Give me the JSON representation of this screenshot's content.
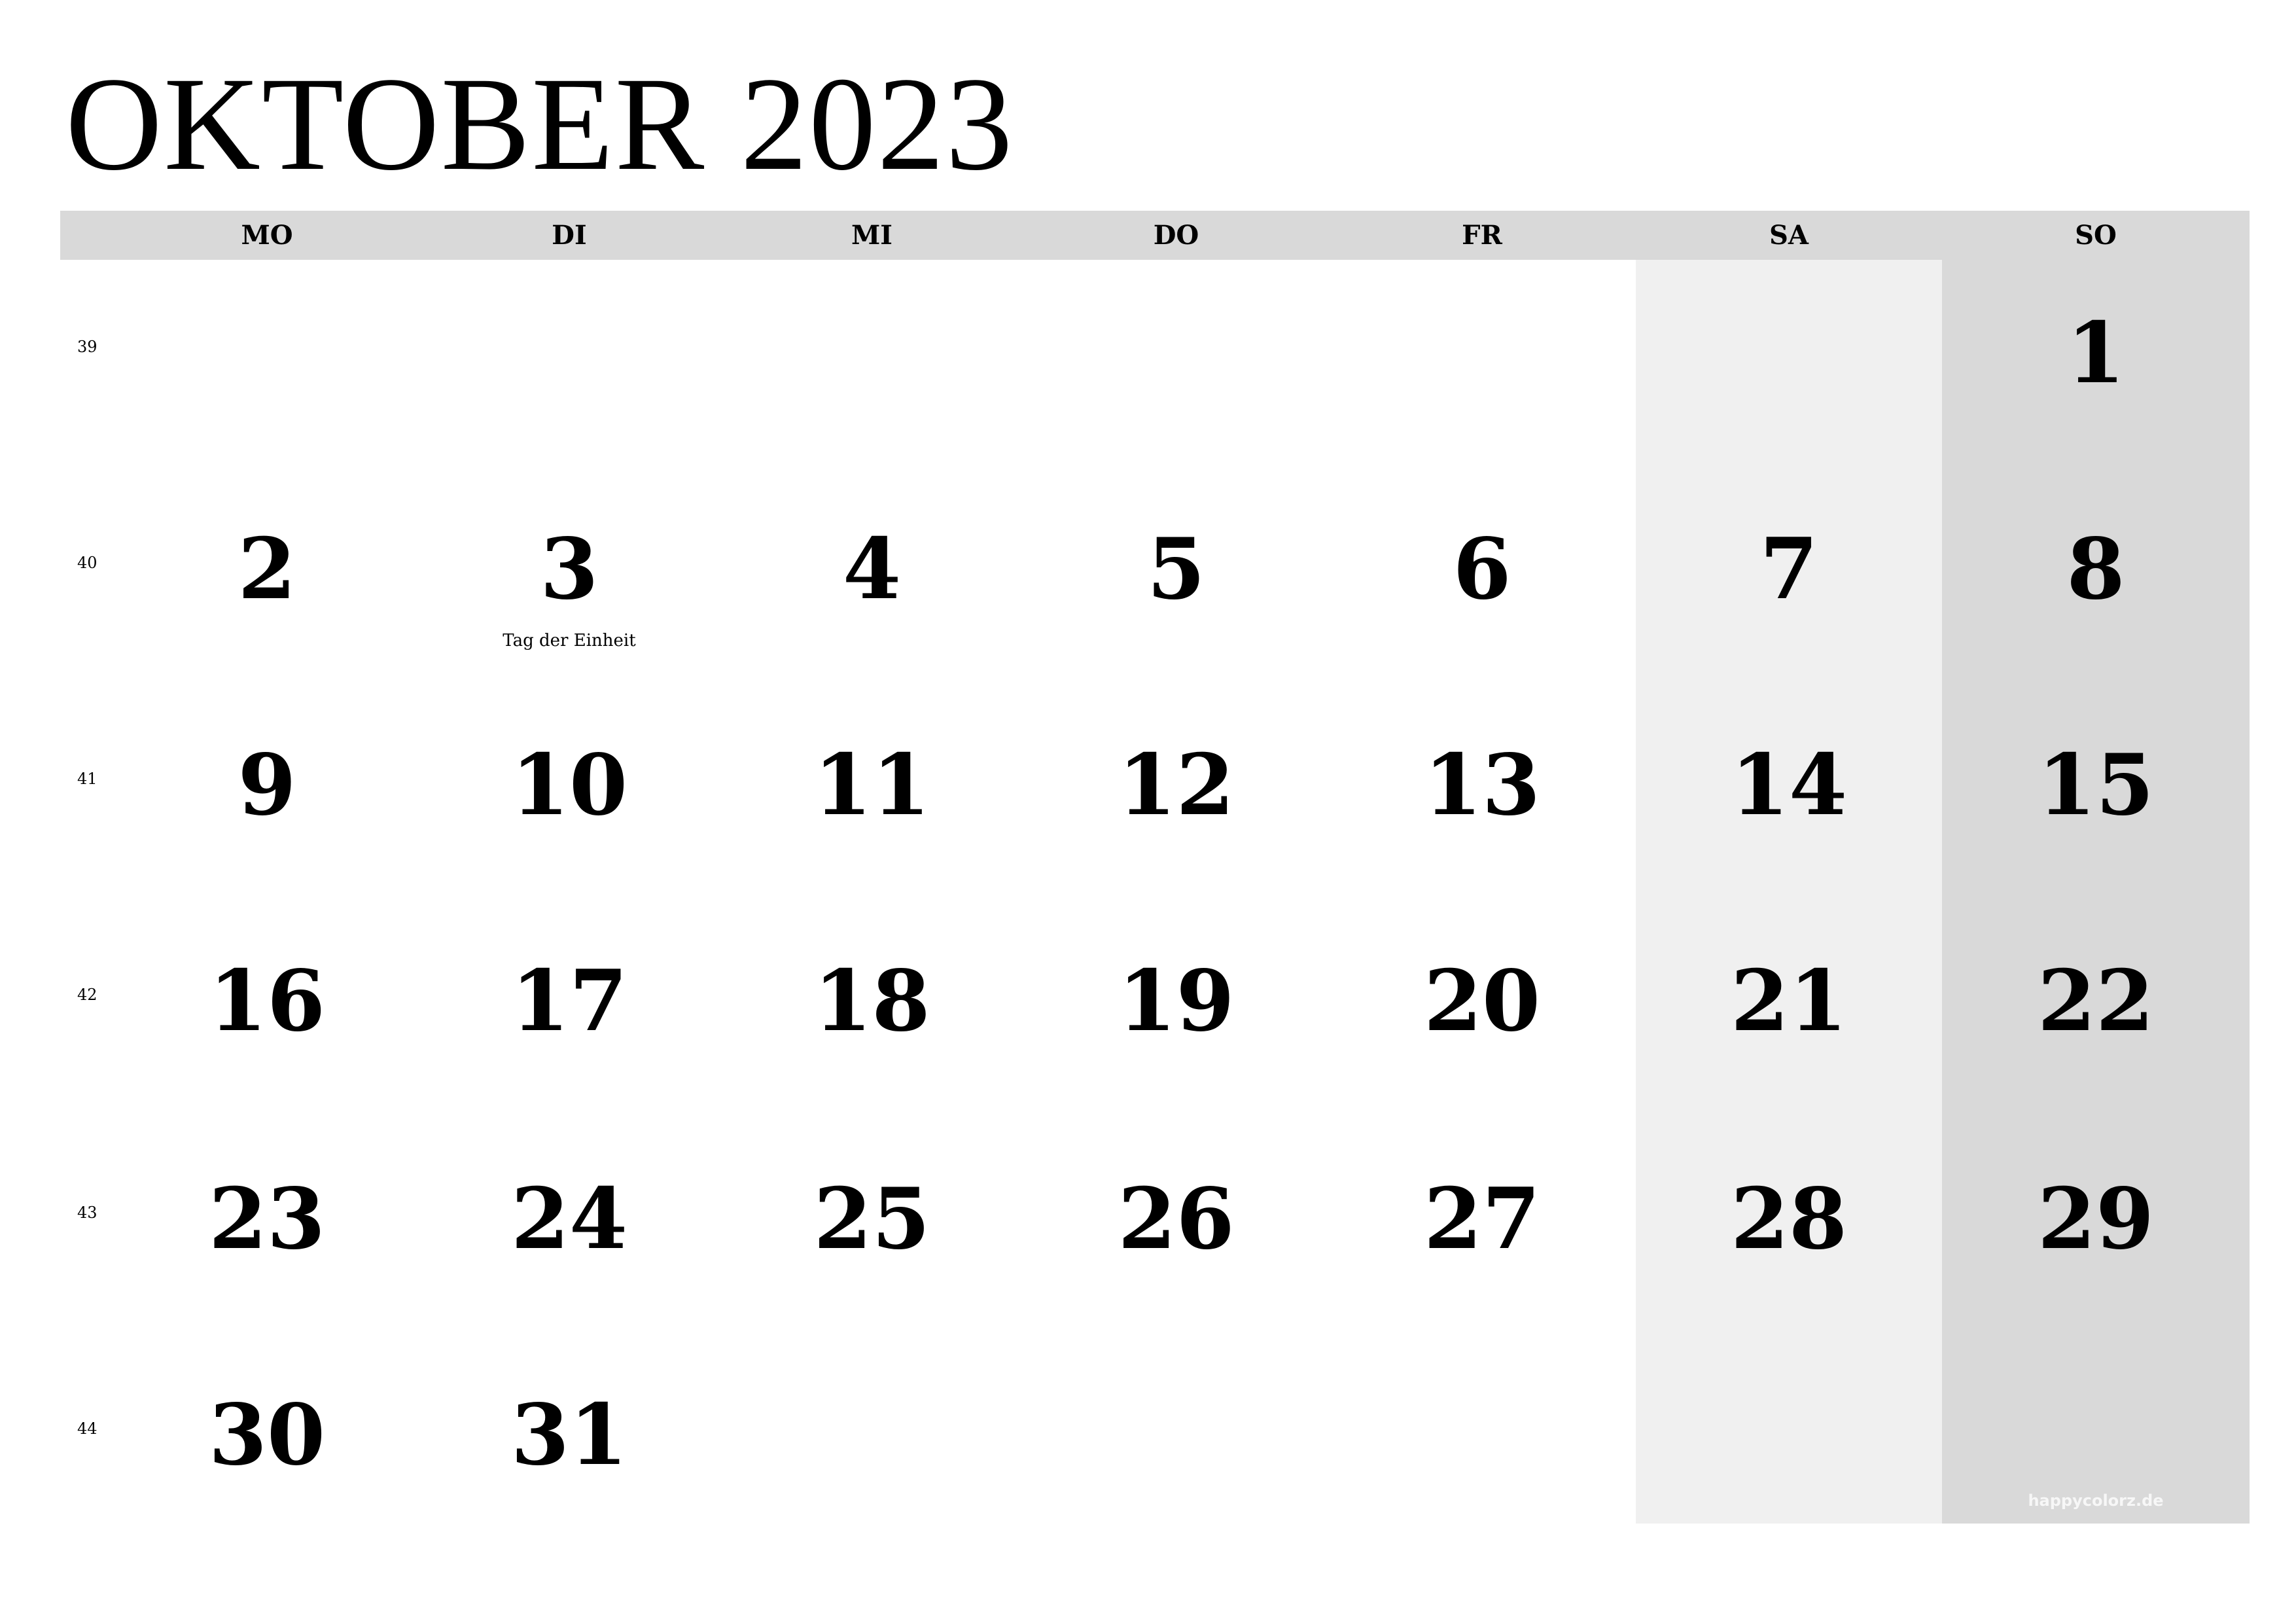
{
  "calendar": {
    "title": "OKTOBER 2023",
    "weekdays": [
      "MO",
      "DI",
      "MI",
      "DO",
      "FR",
      "SA",
      "SO"
    ],
    "weeks": [
      {
        "number": "39",
        "days": [
          "",
          "",
          "",
          "",
          "",
          "",
          "1"
        ]
      },
      {
        "number": "40",
        "days": [
          "2",
          "3",
          "4",
          "5",
          "6",
          "7",
          "8"
        ]
      },
      {
        "number": "41",
        "days": [
          "9",
          "10",
          "11",
          "12",
          "13",
          "14",
          "15"
        ]
      },
      {
        "number": "42",
        "days": [
          "16",
          "17",
          "18",
          "19",
          "20",
          "21",
          "22"
        ]
      },
      {
        "number": "43",
        "days": [
          "23",
          "24",
          "25",
          "26",
          "27",
          "28",
          "29"
        ]
      },
      {
        "number": "44",
        "days": [
          "30",
          "31",
          "",
          "",
          "",
          "",
          ""
        ]
      }
    ],
    "holiday": {
      "day": "3",
      "label": "Tag der Einheit"
    },
    "watermark": "happycolorz.de",
    "colors": {
      "header": "#d9d9d9",
      "saturday": "#f0f0f0",
      "sunday": "#d9d9d9",
      "text": "#000000"
    }
  }
}
